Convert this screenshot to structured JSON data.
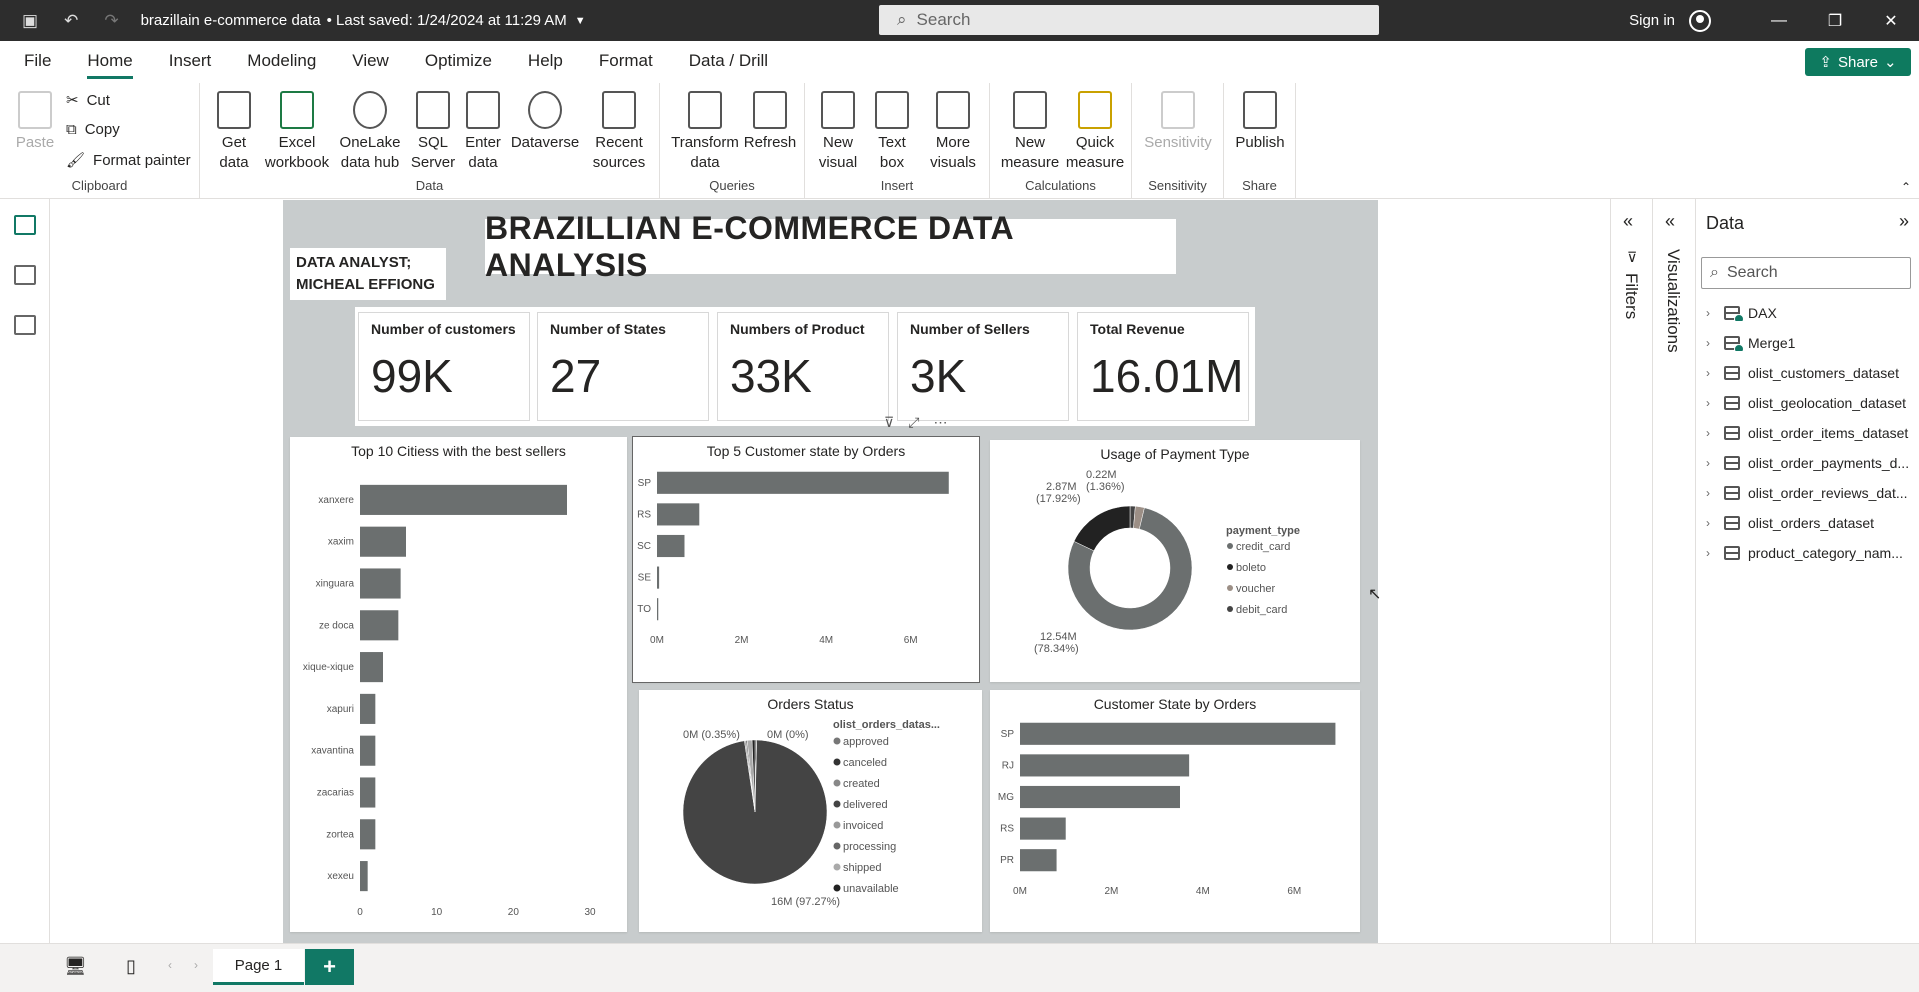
{
  "titlebar": {
    "file_name": "brazillain e-commerce data",
    "saved": "• Last saved: 1/24/2024 at 11:29 AM",
    "search_placeholder": "Search",
    "signin": "Sign in"
  },
  "menu": [
    "File",
    "Home",
    "Insert",
    "Modeling",
    "View",
    "Optimize",
    "Help",
    "Format",
    "Data / Drill"
  ],
  "share_label": "Share",
  "ribbon": {
    "clipboard": {
      "paste": "Paste",
      "cut": "Cut",
      "copy": "Copy",
      "format_painter": "Format painter",
      "group": "Clipboard"
    },
    "data": {
      "get_data": "Get data",
      "excel": "Excel workbook",
      "onelake": "OneLake data hub",
      "sql": "SQL Server",
      "enter": "Enter data",
      "dataverse": "Dataverse",
      "recent": "Recent sources",
      "group": "Data"
    },
    "queries": {
      "transform": "Transform data",
      "refresh": "Refresh",
      "group": "Queries"
    },
    "insert": {
      "new_visual": "New visual",
      "text_box": "Text box",
      "more_visuals": "More visuals",
      "group": "Insert"
    },
    "calculations": {
      "new_measure": "New measure",
      "quick_measure": "Quick measure",
      "group": "Calculations"
    },
    "sensitivity": {
      "label": "Sensitivity",
      "group": "Sensitivity"
    },
    "share": {
      "publish": "Publish",
      "group": "Share"
    }
  },
  "report": {
    "title": "BRAZILLIAN E-COMMERCE DATA ANALYSIS",
    "analyst_line1": "DATA ANALYST;",
    "analyst_line2": "MICHEAL EFFIONG",
    "kpis": [
      {
        "label": "Number of customers",
        "value": "99K"
      },
      {
        "label": "Number of States",
        "value": "27"
      },
      {
        "label": "Numbers of Product",
        "value": "33K"
      },
      {
        "label": "Number of Sellers",
        "value": "3K"
      },
      {
        "label": "Total Revenue",
        "value": "16.01M"
      }
    ]
  },
  "chart_data": [
    {
      "type": "bar",
      "title": "Top 10 Citiess with the best sellers",
      "categories": [
        "xanxere",
        "xaxim",
        "xinguara",
        "ze doca",
        "xique-xique",
        "xapuri",
        "xavantina",
        "zacarias",
        "zortea",
        "xexeu"
      ],
      "values": [
        27,
        6,
        5.3,
        5,
        3,
        2,
        2,
        2,
        2,
        1
      ],
      "xticks": [
        "0",
        "10",
        "20",
        "30"
      ],
      "xlim": [
        0,
        30
      ]
    },
    {
      "type": "bar",
      "title": "Top 5 Customer state by Orders",
      "categories": [
        "SP",
        "RS",
        "SC",
        "SE",
        "TO"
      ],
      "values": [
        6.9,
        1.0,
        0.65,
        0.05,
        0.03
      ],
      "xticks": [
        "0M",
        "2M",
        "4M",
        "6M"
      ],
      "xlim": [
        0,
        7
      ]
    },
    {
      "type": "pie",
      "title": "Usage of Payment Type",
      "donut": true,
      "legend_title": "payment_type",
      "slices": [
        {
          "name": "credit_card",
          "value": 12.54,
          "label": "12.54M",
          "pct": "(78.34%)",
          "color": "#6b6f6f"
        },
        {
          "name": "boleto",
          "value": 2.87,
          "label": "2.87M",
          "pct": "(17.92%)",
          "color": "#222222"
        },
        {
          "name": "voucher",
          "value": 0.38,
          "label": "",
          "pct": "",
          "color": "#9c8f86"
        },
        {
          "name": "debit_card",
          "value": 0.22,
          "label": "0.22M",
          "pct": "(1.36%)",
          "color": "#444"
        }
      ]
    },
    {
      "type": "pie",
      "title": "Orders Status",
      "legend_title": "olist_orders_datas...",
      "slices": [
        {
          "name": "approved",
          "value": 0.02,
          "color": "#777"
        },
        {
          "name": "canceled",
          "value": 0.35,
          "color": "#333"
        },
        {
          "name": "created",
          "value": 0.01,
          "color": "#888"
        },
        {
          "name": "delivered",
          "value": 97.27,
          "color": "#444"
        },
        {
          "name": "invoiced",
          "value": 0.3,
          "color": "#999"
        },
        {
          "name": "processing",
          "value": 0.3,
          "color": "#666"
        },
        {
          "name": "shipped",
          "value": 1.1,
          "color": "#aaa"
        },
        {
          "name": "unavailable",
          "value": 0.65,
          "color": "#222"
        }
      ],
      "labels": {
        "a": "0M (0.35%)",
        "b": "0M (0%)",
        "c": "16M (97.27%)"
      }
    },
    {
      "type": "bar",
      "title": "Customer State by Orders",
      "categories": [
        "SP",
        "RJ",
        "MG",
        "RS",
        "PR"
      ],
      "values": [
        6.9,
        3.7,
        3.5,
        1.0,
        0.8
      ],
      "xticks": [
        "0M",
        "2M",
        "4M",
        "6M"
      ],
      "xlim": [
        0,
        7
      ]
    }
  ],
  "panes": {
    "filters": "Filters",
    "visualizations": "Visualizations"
  },
  "data_pane": {
    "title": "Data",
    "search_placeholder": "Search",
    "fields": [
      "DAX",
      "Merge1",
      "olist_customers_dataset",
      "olist_geolocation_dataset",
      "olist_order_items_dataset",
      "olist_order_payments_d...",
      "olist_order_reviews_dat...",
      "olist_orders_dataset",
      "product_category_nam..."
    ]
  },
  "pages": {
    "tab": "Page 1",
    "add": "+"
  },
  "colors": {
    "accent": "#117865",
    "bar": "#6b6f6f",
    "canvas": "#c8cccd"
  }
}
